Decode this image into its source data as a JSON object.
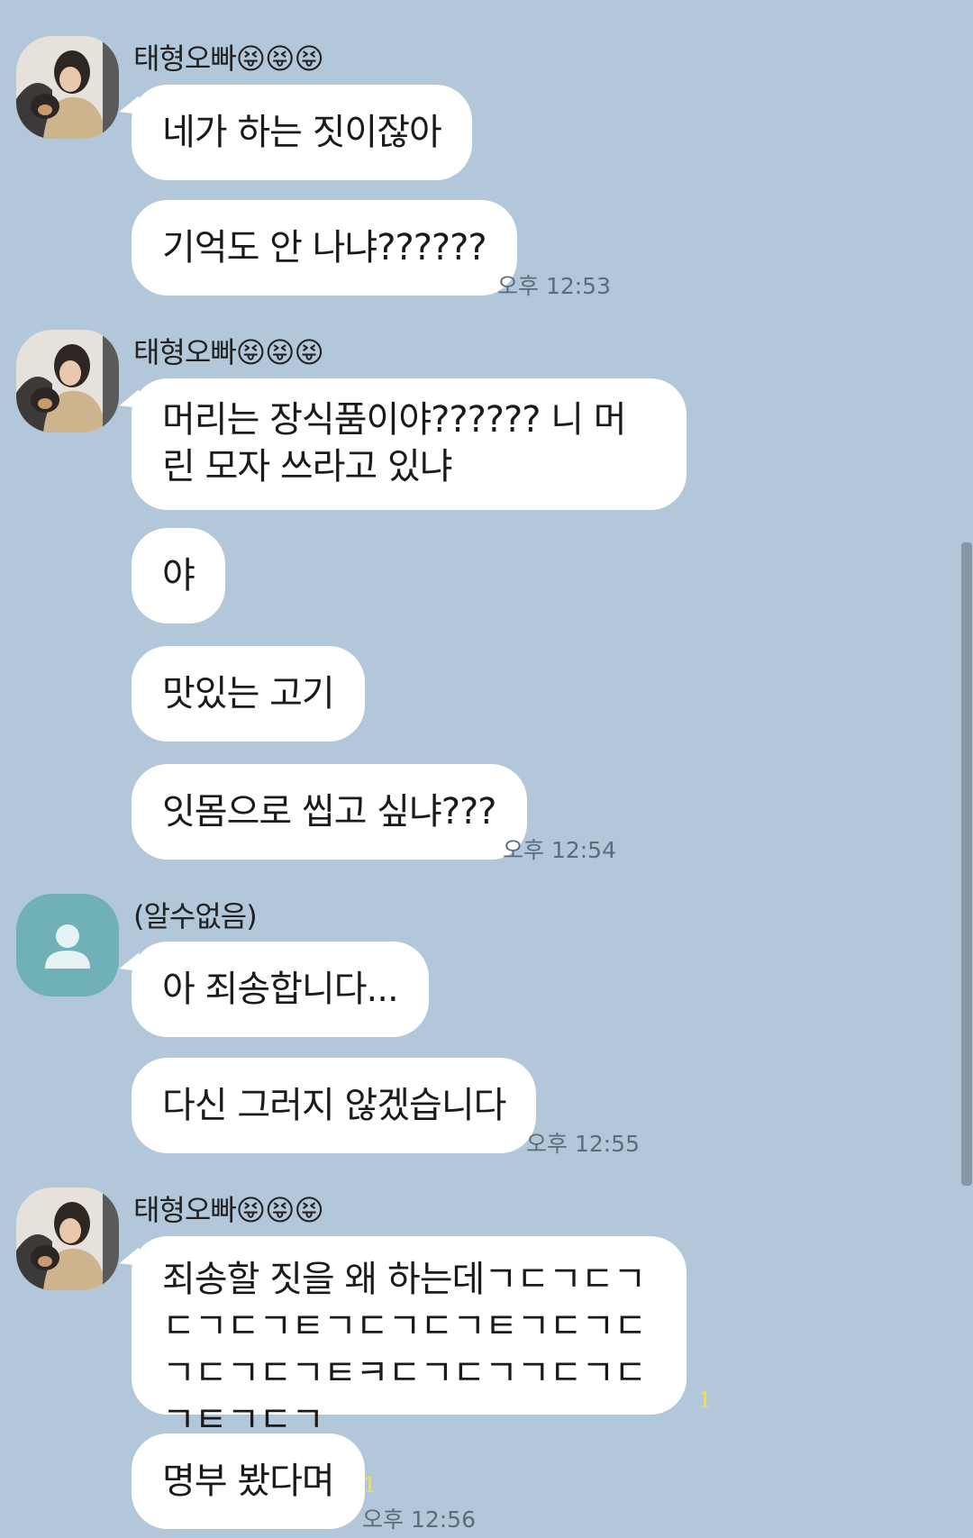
{
  "messages": {
    "g1": {
      "sender": "태형오빠😝😝😝",
      "bubbles": [
        "네가 하는 짓이잖아",
        "기억도 안 나냐??????"
      ],
      "time": "오후 12:53"
    },
    "g2": {
      "sender": "태형오빠😝😝😝",
      "bubbles": [
        "머리는 장식품이야?????? 니 머린 모자 쓰라고 있냐",
        "야",
        "맛있는 고기",
        "잇몸으로 씹고 싶냐???"
      ],
      "time": "오후 12:54"
    },
    "g3": {
      "sender": "(알수없음)",
      "bubbles": [
        "아 죄송합니다...",
        "다신 그러지 않겠습니다"
      ],
      "time": "오후 12:55"
    },
    "g4": {
      "sender": "태형오빠😝😝😝",
      "bubbles": [
        "죄송할 짓을 왜 하는데ㄱㄷㄱㄷㄱㄷㄱㄷㄱㅌㄱㄷㄱㄷㄱㅌㄱㄷㄱㄷㄱㄷㄱㄷㄱㅌㅋㄷㄱㄷㄱㄱㄷㄱㄷㄱㅌㄱㄷㄱ",
        "명부 봤다며"
      ],
      "unread": [
        "1",
        "1"
      ],
      "time": "오후 12:56"
    }
  },
  "icons": {
    "avatar_photo": "profile-photo",
    "avatar_unknown": "person-icon"
  },
  "colors": {
    "background": "#b2c7d9",
    "bubble": "#ffffff",
    "unread": "#f5e23a",
    "unknown_avatar": "#6fb1b6"
  }
}
